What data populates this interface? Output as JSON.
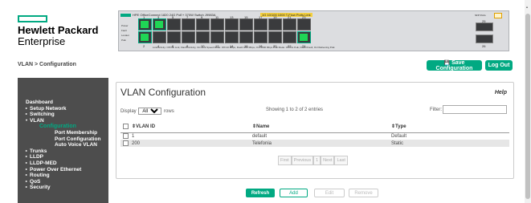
{
  "brand": {
    "line1": "Hewlett Packard",
    "line2": "Enterprise",
    "color": "#01a982"
  },
  "switch_panel": {
    "title": "HPE OfficeConnect 1820 24G PoE+ 370W Switch J9983A",
    "status_tag": "1G 10/100 1000 T-Flow Ports Link",
    "top_port_numbers": [
      "1",
      "3",
      "5",
      "7",
      "9",
      "11",
      "13",
      "15",
      "17",
      "19",
      "21",
      "23"
    ],
    "bottom_port_numbers": [
      "2",
      "4",
      "6",
      "8",
      "10",
      "12",
      "14",
      "16",
      "18",
      "20",
      "22",
      "24"
    ],
    "active_ports": [
      "1",
      "3",
      "2",
      "24"
    ],
    "sfp_label": "SFP Ports",
    "sfp_numbers": [
      "25",
      "26"
    ],
    "led_labels": [
      "Power",
      "Fault",
      "Locator",
      "PoE"
    ],
    "legend": "Link/Activity: Off=No Link, Flash=Activity, On=Link   Speed Mode: Off=10 Mbps, Flash=100 Mbps, On=1000 Mbps   PoE Mode: Off=No PoE, Flash=Fault, On=Delivering PoE"
  },
  "breadcrumb": "VLAN > Configuration",
  "toolbar": {
    "save_label": "Save Configuration",
    "logout_label": "Log Out"
  },
  "sidebar": {
    "items": [
      {
        "label": "Dashboard",
        "kind": "plain"
      },
      {
        "label": "Setup Network",
        "kind": "collapsed"
      },
      {
        "label": "Switching",
        "kind": "collapsed"
      },
      {
        "label": "VLAN",
        "kind": "expanded"
      },
      {
        "label": "Configuration",
        "kind": "current"
      },
      {
        "label": "Port Membership",
        "kind": "sub"
      },
      {
        "label": "Port Configuration",
        "kind": "sub"
      },
      {
        "label": "Auto Voice VLAN",
        "kind": "sub"
      },
      {
        "label": "Trunks",
        "kind": "collapsed"
      },
      {
        "label": "LLDP",
        "kind": "collapsed"
      },
      {
        "label": "LLDP-MED",
        "kind": "collapsed"
      },
      {
        "label": "Power Over Ethernet",
        "kind": "collapsed"
      },
      {
        "label": "Routing",
        "kind": "collapsed"
      },
      {
        "label": "QoS",
        "kind": "collapsed"
      },
      {
        "label": "Security",
        "kind": "collapsed"
      }
    ]
  },
  "main": {
    "title": "VLAN Configuration",
    "help": "Help",
    "display_label": "Display",
    "display_value": "All",
    "display_suffix": "rows",
    "entries_info": "Showing 1 to 2 of 2 entries",
    "filter_label": "Filter:",
    "filter_value": "",
    "table": {
      "headers": [
        "VLAN ID",
        "Name",
        "Type"
      ],
      "rows": [
        {
          "vlan_id": "1",
          "name": "default",
          "type": "Default"
        },
        {
          "vlan_id": "200",
          "name": "Telefonia",
          "type": "Static"
        }
      ]
    },
    "pagination": [
      "First",
      "Previous",
      "1",
      "Next",
      "Last"
    ]
  },
  "actions": {
    "refresh": "Refresh",
    "add": "Add",
    "edit": "Edit",
    "remove": "Remove"
  }
}
